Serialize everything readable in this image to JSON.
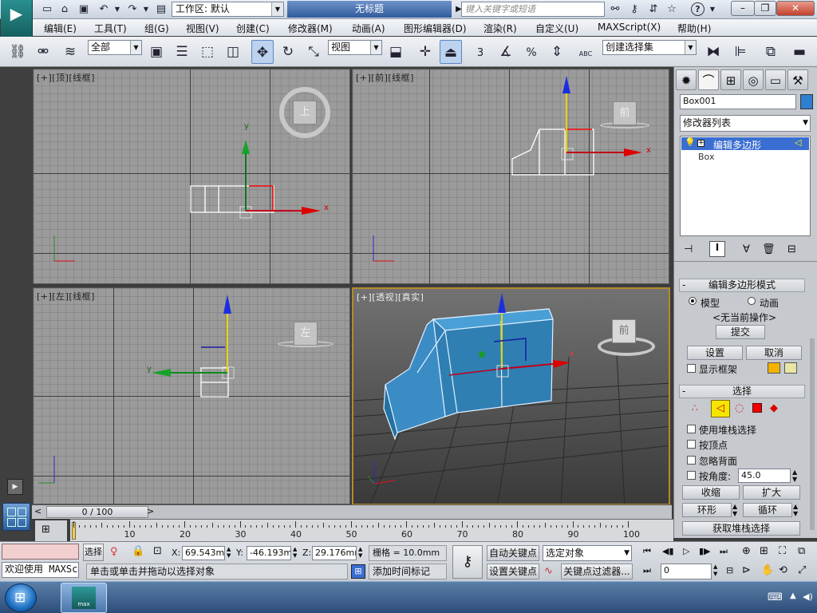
{
  "app": {
    "doc_title": "无标题",
    "workspace_label": "工作区: 默认",
    "search_placeholder": "键入关键字或短语",
    "logo_text": "max"
  },
  "menu": [
    "编辑(E)",
    "工具(T)",
    "组(G)",
    "视图(V)",
    "创建(C)",
    "修改器(M)",
    "动画(A)",
    "图形编辑器(D)",
    "渲染(R)",
    "自定义(U)",
    "MAXScript(X)",
    "帮助(H)"
  ],
  "toolbar": {
    "selection_filter": "全部",
    "coord_system": "视图",
    "named_selection": "创建选择集",
    "snap_3_label": "3",
    "percent_label": "%",
    "abc_label": "ABC"
  },
  "viewports": {
    "top": {
      "label": "[+][顶][线框]",
      "cube": "上"
    },
    "front": {
      "label": "[+][前][线框]",
      "cube": "前"
    },
    "left": {
      "label": "[+][左][线框]",
      "cube": "左"
    },
    "persp": {
      "label": "[+][透视][真实]",
      "cube": "前"
    }
  },
  "axes": {
    "x": "x",
    "y": "y",
    "z": "z"
  },
  "command_panel": {
    "object_name": "Box001",
    "object_color": "#2f7fd0",
    "modifier_list": "修改器列表",
    "stack": [
      "编辑多边形",
      "Box"
    ],
    "edit_poly_mode": {
      "title": "编辑多边形模式",
      "model": "模型",
      "animate": "动画",
      "current_op": "<无当前操作>",
      "commit": "提交",
      "settings": "设置",
      "cancel": "取消",
      "show_cage": "显示框架"
    },
    "selection": {
      "title": "选择",
      "use_stack": "使用堆栈选择",
      "by_vertex": "按顶点",
      "ignore_back": "忽略背面",
      "by_angle": "按角度:",
      "angle_value": "45.0",
      "shrink": "收缩",
      "grow": "扩大",
      "ring": "环形",
      "loop": "循环",
      "get_stack": "获取堆栈选择"
    }
  },
  "timeline": {
    "frame": "0 / 100",
    "ticks": [
      "0",
      "10",
      "20",
      "30",
      "40",
      "50",
      "60",
      "70",
      "80",
      "90",
      "100"
    ]
  },
  "status": {
    "maxscript_listener": "欢迎使用  MAXSc",
    "select_label": "选择",
    "x_label": "X:",
    "x_value": "69.543mm",
    "y_label": "Y:",
    "y_value": "-46.193mm",
    "z_label": "Z:",
    "z_value": "29.176mm",
    "grid": "栅格 = 10.0mm",
    "prompt": "单击或单击并拖动以选择对象",
    "add_time_tag": "添加时间标记",
    "auto_key": "自动关键点",
    "set_key": "设置关键点",
    "selected_object": "选定对象",
    "key_filters": "关键点过滤器...",
    "current_frame": "0"
  }
}
